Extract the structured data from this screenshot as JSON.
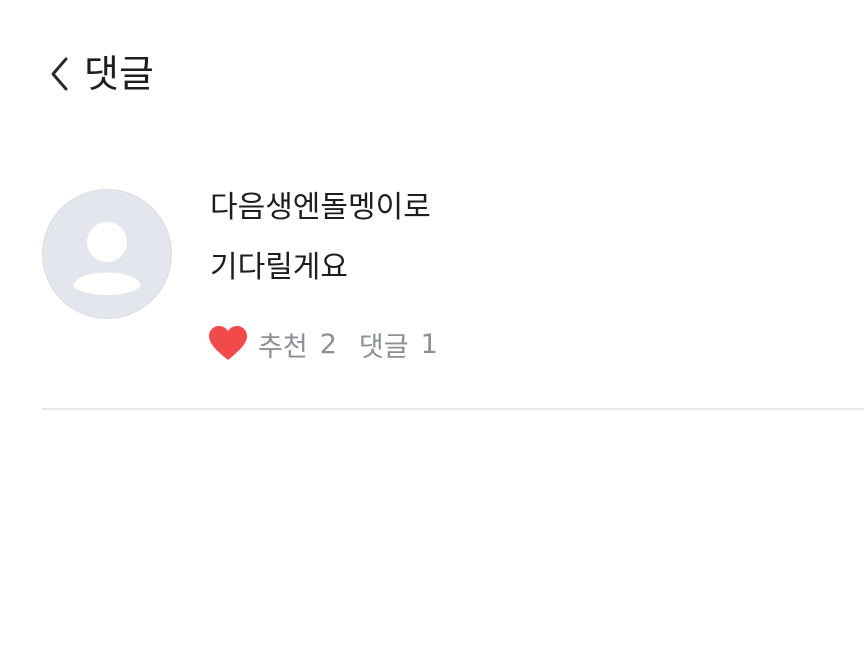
{
  "header": {
    "back_icon": "chevron-left-icon",
    "title": "댓글"
  },
  "comment": {
    "avatar_icon": "default-user-avatar",
    "author": "다음생엔돌멩이로",
    "text": "기다릴게요",
    "like_icon": "heart-icon",
    "like_color": "#f04a4a",
    "like_label": "추천",
    "like_count": "2",
    "reply_label": "댓글",
    "reply_count": "1"
  },
  "colors": {
    "text_primary": "#1e1e1e",
    "text_secondary": "#8b8f96",
    "avatar_bg": "#e3e6ec",
    "divider": "#e5e5e5"
  }
}
